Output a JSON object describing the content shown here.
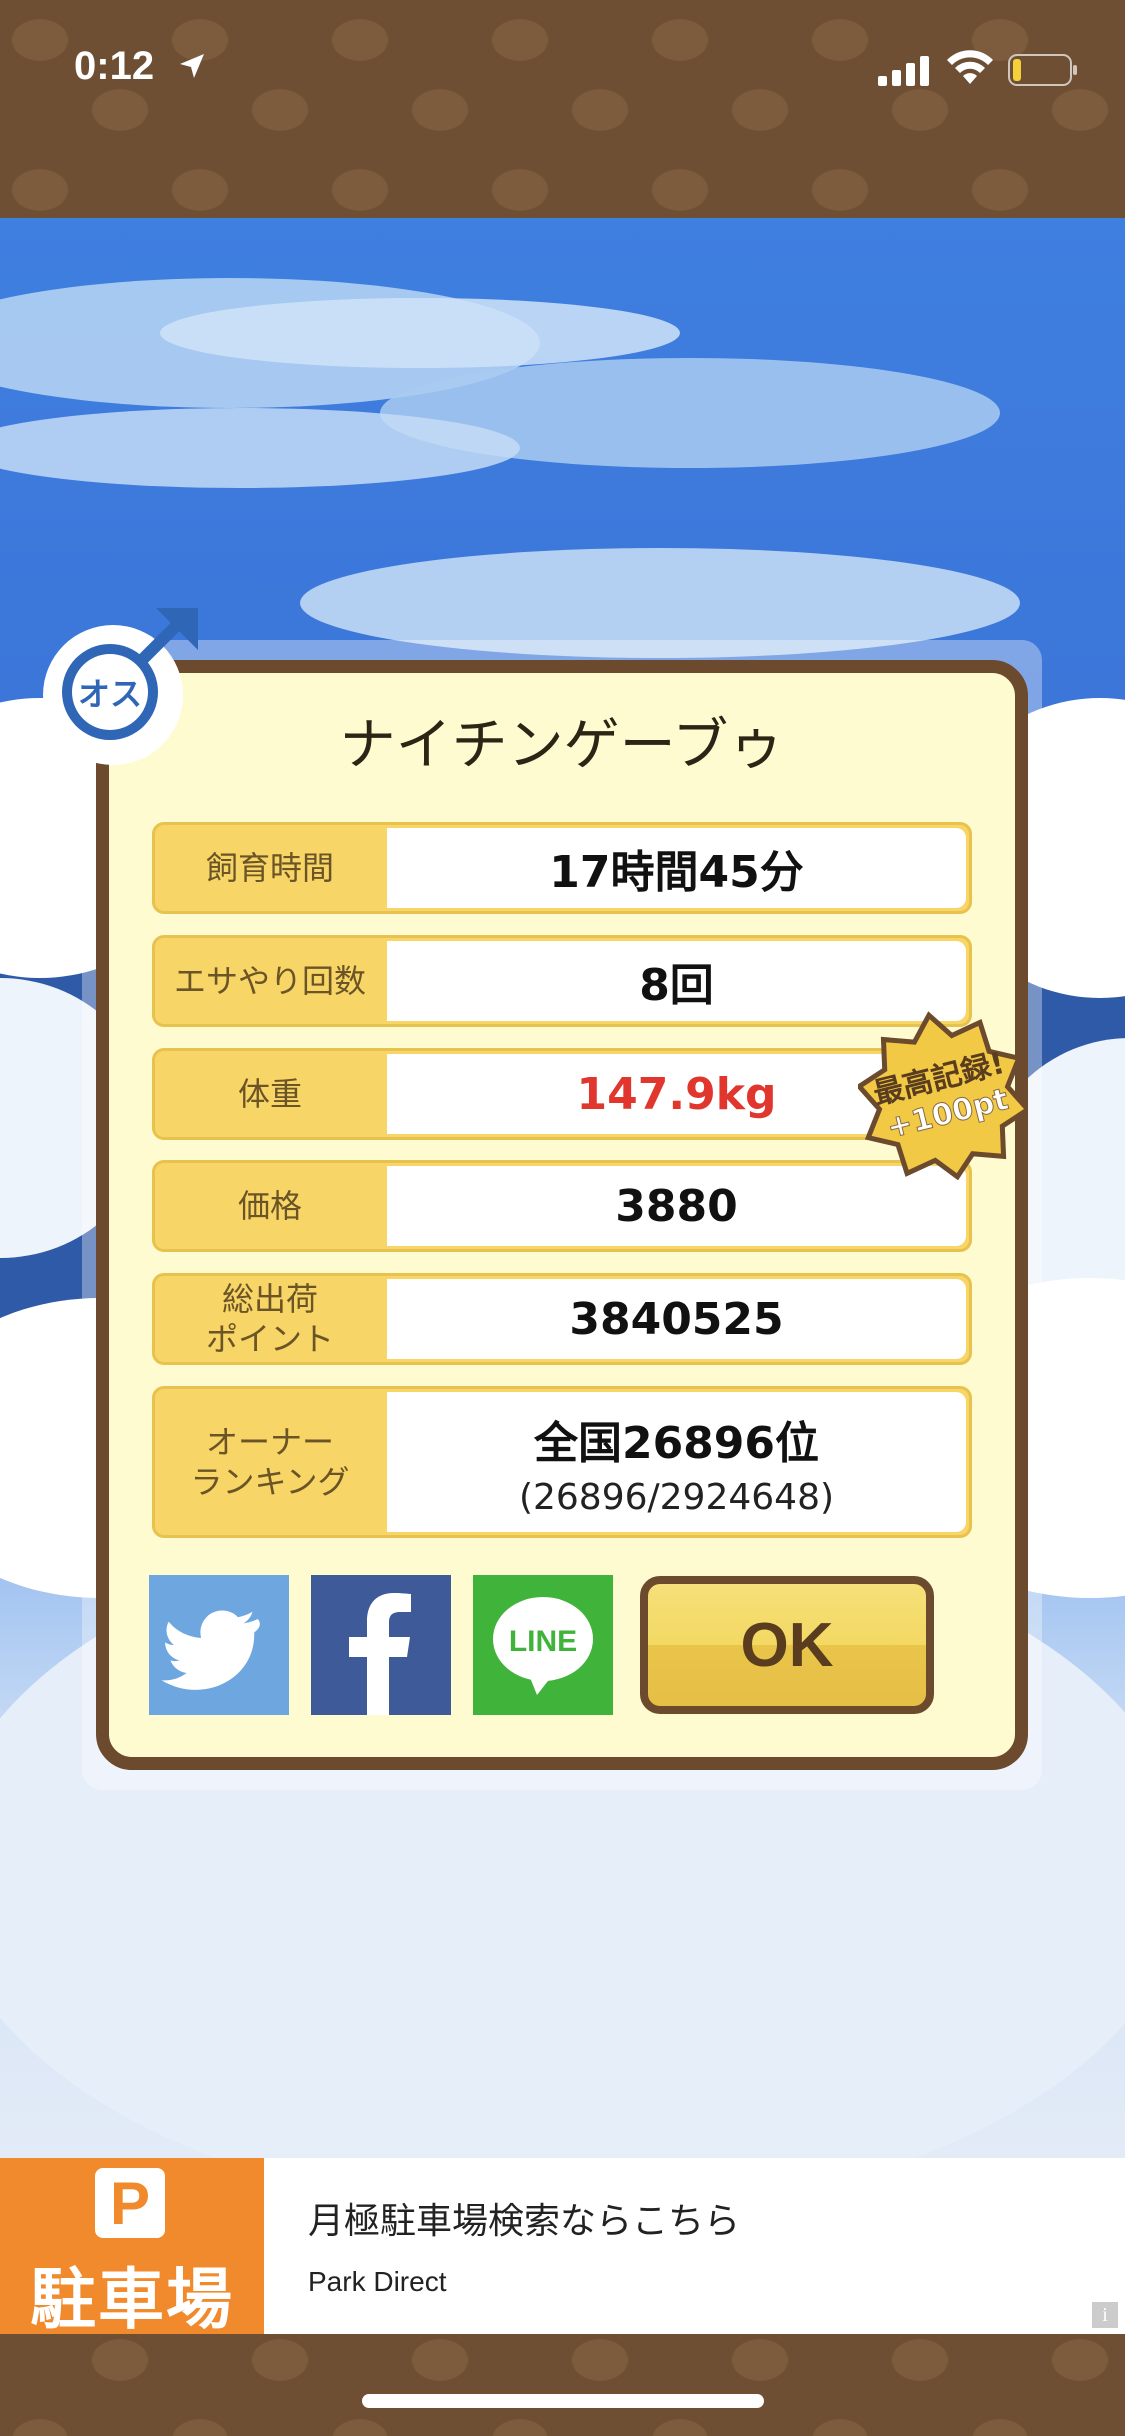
{
  "status_bar": {
    "time": "0:12"
  },
  "icons": {
    "location": "location-arrow-icon",
    "signal": "cellular-signal-icon",
    "wifi": "wifi-icon",
    "battery": "battery-low-icon"
  },
  "pet": {
    "gender_badge": "オス",
    "name": "ナイチンゲーブゥ"
  },
  "stats": [
    {
      "label": "飼育時間",
      "value": "17時間45分"
    },
    {
      "label": "エサやり回数",
      "value": "8回"
    },
    {
      "label": "体重",
      "value": "147.9kg"
    },
    {
      "label": "価格",
      "value": "3880"
    },
    {
      "label": "総出荷\nポイント",
      "value": "3840525"
    },
    {
      "label": "オーナー\nランキング",
      "value": "全国26896位",
      "sub": "(26896/2924648)"
    }
  ],
  "record_badge": {
    "line1": "最高記録!",
    "line2": "+100pt"
  },
  "share": {
    "twitter": "twitter-icon",
    "facebook": "facebook-icon",
    "line_label": "LINE"
  },
  "ok_button": "OK",
  "ad": {
    "logo_p": "P",
    "logo_text": "駐車場",
    "title": "月極駐車場検索ならこちら",
    "subtitle": "Park Direct",
    "info": "i"
  },
  "colors": {
    "accent_yellow": "#f7d567",
    "frame_brown": "#6b4a2e",
    "weight_red": "#e1362e",
    "ad_orange": "#f08a2c"
  }
}
